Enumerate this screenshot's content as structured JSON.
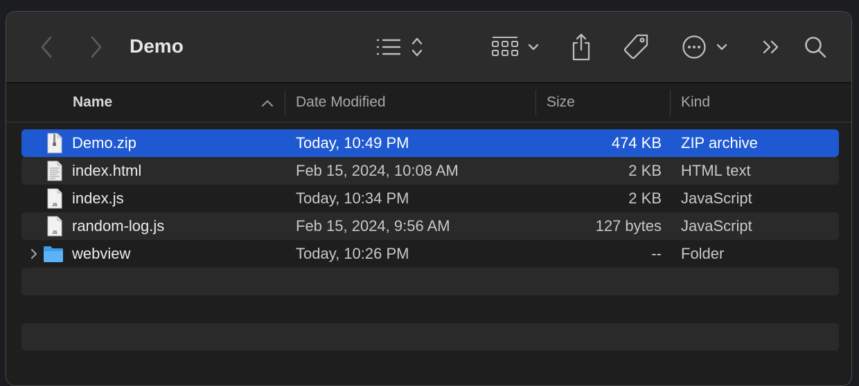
{
  "window": {
    "title": "Demo"
  },
  "toolbar": {
    "icons": [
      "back-icon",
      "forward-icon",
      "list-view-icon",
      "sort-updown-icon",
      "group-grid-icon",
      "chevron-down-icon",
      "share-icon",
      "tag-icon",
      "more-icon",
      "chevron-down-icon",
      "overflow-icon",
      "search-icon"
    ]
  },
  "columns": {
    "name": "Name",
    "date": "Date Modified",
    "size": "Size",
    "kind": "Kind"
  },
  "files": [
    {
      "name": "Demo.zip",
      "date": "Today, 10:49 PM",
      "size": "474 KB",
      "kind": "ZIP archive",
      "icon": "zip-file-icon",
      "selected": true
    },
    {
      "name": "index.html",
      "date": "Feb 15, 2024, 10:08 AM",
      "size": "2 KB",
      "kind": "HTML text",
      "icon": "html-file-icon"
    },
    {
      "name": "index.js",
      "date": "Today, 10:34 PM",
      "size": "2 KB",
      "kind": "JavaScript",
      "icon": "js-file-icon"
    },
    {
      "name": "random-log.js",
      "date": "Feb 15, 2024, 9:56 AM",
      "size": "127 bytes",
      "kind": "JavaScript",
      "icon": "js-file-icon"
    },
    {
      "name": "webview",
      "date": "Today, 10:26 PM",
      "size": "--",
      "kind": "Folder",
      "icon": "folder-icon"
    }
  ],
  "colors": {
    "selection": "#1f59d1",
    "toolbar": "#2c2c2c",
    "background": "#1e1e1e",
    "stripe": "#2a2a2a"
  }
}
